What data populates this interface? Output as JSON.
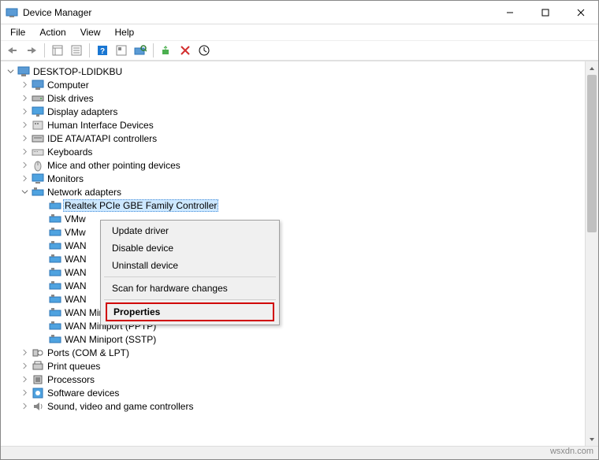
{
  "window": {
    "title": "Device Manager"
  },
  "menubar": [
    "File",
    "Action",
    "View",
    "Help"
  ],
  "root": {
    "label": "DESKTOP-LDIDKBU"
  },
  "categories": [
    {
      "label": "Computer",
      "icon": "computer"
    },
    {
      "label": "Disk drives",
      "icon": "disk"
    },
    {
      "label": "Display adapters",
      "icon": "display"
    },
    {
      "label": "Human Interface Devices",
      "icon": "hid"
    },
    {
      "label": "IDE ATA/ATAPI controllers",
      "icon": "ide"
    },
    {
      "label": "Keyboards",
      "icon": "keyboard"
    },
    {
      "label": "Mice and other pointing devices",
      "icon": "mouse"
    },
    {
      "label": "Monitors",
      "icon": "monitor"
    }
  ],
  "network": {
    "label": "Network adapters",
    "selected": "Realtek PCIe GBE Family Controller",
    "children": [
      "Realtek PCIe GBE Family Controller",
      "VMw",
      "VMw",
      "WAN",
      "WAN",
      "WAN",
      "WAN",
      "WAN",
      "WAN Miniport (PPPOE)",
      "WAN Miniport (PPTP)",
      "WAN Miniport (SSTP)"
    ]
  },
  "after": [
    {
      "label": "Ports (COM & LPT)",
      "icon": "port"
    },
    {
      "label": "Print queues",
      "icon": "printer"
    },
    {
      "label": "Processors",
      "icon": "cpu"
    },
    {
      "label": "Software devices",
      "icon": "software"
    },
    {
      "label": "Sound, video and game controllers",
      "icon": "sound"
    }
  ],
  "contextmenu": {
    "update": "Update driver",
    "disable": "Disable device",
    "uninstall": "Uninstall device",
    "scan": "Scan for hardware changes",
    "properties": "Properties"
  },
  "watermark": "wsxdn.com"
}
